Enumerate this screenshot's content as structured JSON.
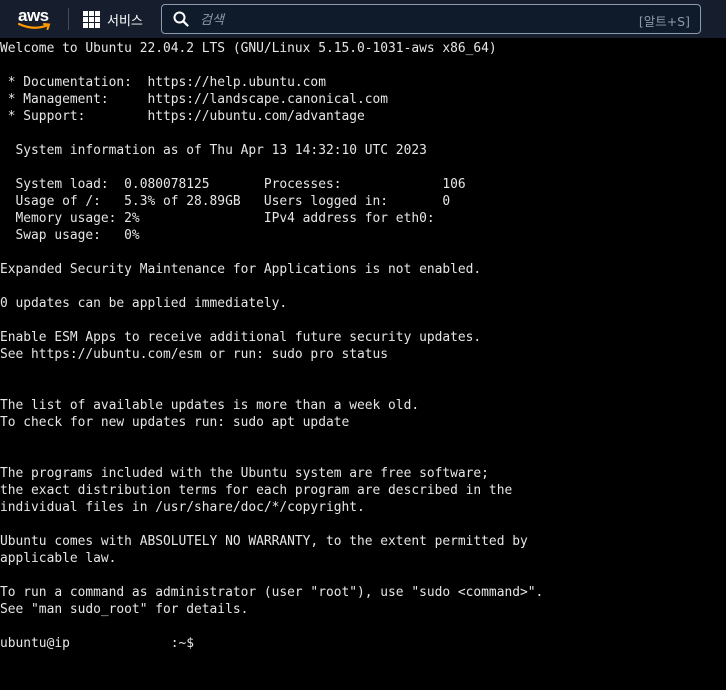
{
  "header": {
    "logo_text": "aws",
    "services_label": "서비스",
    "search_placeholder": "검색",
    "search_shortcut": "[알트+S]"
  },
  "terminal": {
    "lines": [
      "Welcome to Ubuntu 22.04.2 LTS (GNU/Linux 5.15.0-1031-aws x86_64)",
      "",
      " * Documentation:  https://help.ubuntu.com",
      " * Management:     https://landscape.canonical.com",
      " * Support:        https://ubuntu.com/advantage",
      "",
      "  System information as of Thu Apr 13 14:32:10 UTC 2023",
      "",
      "  System load:  0.080078125       Processes:             106",
      "  Usage of /:   5.3% of 28.89GB   Users logged in:       0",
      "  Memory usage: 2%                IPv4 address for eth0:",
      "  Swap usage:   0%",
      "",
      "Expanded Security Maintenance for Applications is not enabled.",
      "",
      "0 updates can be applied immediately.",
      "",
      "Enable ESM Apps to receive additional future security updates.",
      "See https://ubuntu.com/esm or run: sudo pro status",
      "",
      "",
      "The list of available updates is more than a week old.",
      "To check for new updates run: sudo apt update",
      "",
      "",
      "The programs included with the Ubuntu system are free software;",
      "the exact distribution terms for each program are described in the",
      "individual files in /usr/share/doc/*/copyright.",
      "",
      "Ubuntu comes with ABSOLUTELY NO WARRANTY, to the extent permitted by",
      "applicable law.",
      "",
      "To run a command as administrator (user \"root\"), use \"sudo <command>\".",
      "See \"man sudo_root\" for details.",
      ""
    ],
    "prompt": "ubuntu@ip             :~$ "
  }
}
